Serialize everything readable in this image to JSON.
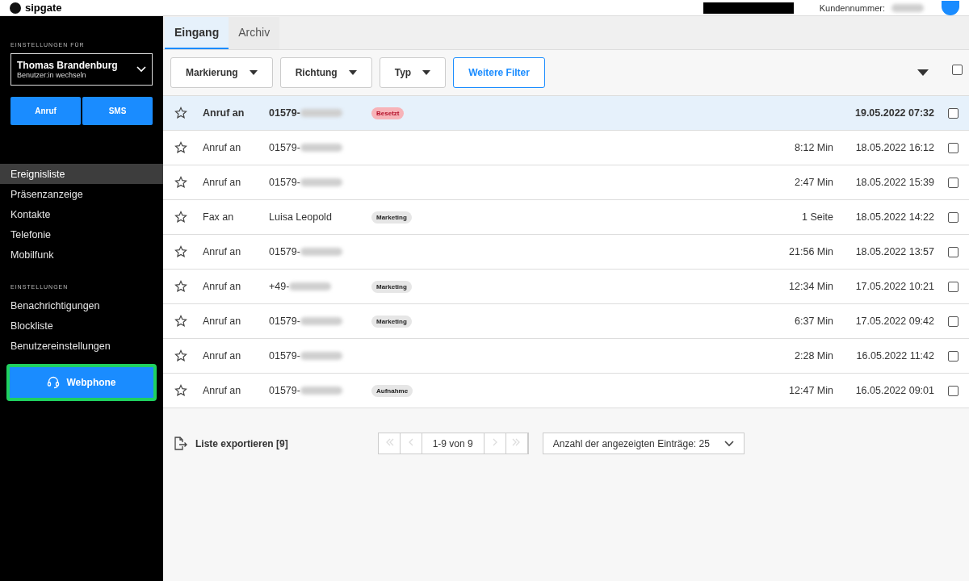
{
  "header": {
    "logo": "sipgate",
    "customer_label": "Kundennummer:"
  },
  "sidebar": {
    "section_label": "EINSTELLUNGEN FÜR",
    "user": {
      "name": "Thomas Brandenburg",
      "hint": "Benutzer:in wechseln"
    },
    "actions": [
      "Anruf",
      "SMS"
    ],
    "nav": [
      {
        "label": "Ereignisliste",
        "selected": true
      },
      {
        "label": "Präsenzanzeige",
        "selected": false
      },
      {
        "label": "Kontakte",
        "selected": false
      },
      {
        "label": "Telefonie",
        "selected": false
      },
      {
        "label": "Mobilfunk",
        "selected": false
      }
    ],
    "settings_label": "EINSTELLUNGEN",
    "settings": [
      {
        "label": "Benachrichtigungen",
        "selected": false
      },
      {
        "label": "Blockliste",
        "selected": false
      },
      {
        "label": "Benutzereinstellungen",
        "selected": false
      }
    ],
    "webphone": {
      "label": "Webphone",
      "highlighted": true
    }
  },
  "tabs": [
    {
      "label": "Eingang",
      "selected": true
    },
    {
      "label": "Archiv",
      "selected": false
    }
  ],
  "filters": [
    {
      "label": "Markierung",
      "kind": "dropdown"
    },
    {
      "label": "Richtung",
      "kind": "dropdown"
    },
    {
      "label": "Typ",
      "kind": "dropdown"
    },
    {
      "label": "Weitere Filter",
      "kind": "link"
    }
  ],
  "select_all": {
    "checked": false
  },
  "rows": [
    {
      "starred": false,
      "unread": true,
      "type": "Anruf an",
      "contact": "01579-",
      "redacted": true,
      "tag": {
        "label": "Besetzt",
        "color": "#f7b3b8"
      },
      "duration": "",
      "date": "19.05.2022 07:32",
      "checked": false
    },
    {
      "starred": false,
      "unread": false,
      "type": "Anruf an",
      "contact": "01579-",
      "redacted": true,
      "duration": "8:12 Min",
      "date": "18.05.2022 16:12",
      "checked": false
    },
    {
      "starred": false,
      "unread": false,
      "type": "Anruf an",
      "contact": "01579-",
      "redacted": true,
      "duration": "2:47 Min",
      "date": "18.05.2022 15:39",
      "checked": false
    },
    {
      "starred": false,
      "unread": false,
      "type": "Fax an",
      "contact": "Luisa Leopold",
      "redacted": false,
      "tag": {
        "label": "Marketing",
        "color": "#e6e6e6"
      },
      "duration": "1 Seite",
      "date": "18.05.2022 14:22",
      "checked": false
    },
    {
      "starred": false,
      "unread": false,
      "type": "Anruf an",
      "contact": "01579-",
      "redacted": true,
      "duration": "21:56 Min",
      "date": "18.05.2022 13:57",
      "checked": false
    },
    {
      "starred": false,
      "unread": false,
      "type": "Anruf an",
      "contact": "+49-",
      "redacted": true,
      "tag": {
        "label": "Marketing",
        "color": "#e6e6e6"
      },
      "duration": "12:34 Min",
      "date": "17.05.2022 10:21",
      "checked": false
    },
    {
      "starred": false,
      "unread": false,
      "type": "Anruf an",
      "contact": "01579-",
      "redacted": true,
      "tag": {
        "label": "Marketing",
        "color": "#e6e6e6"
      },
      "duration": "6:37 Min",
      "date": "17.05.2022 09:42",
      "checked": false
    },
    {
      "starred": false,
      "unread": false,
      "type": "Anruf an",
      "contact": "01579-",
      "redacted": true,
      "duration": "2:28 Min",
      "date": "16.05.2022 11:42",
      "checked": false
    },
    {
      "starred": false,
      "unread": false,
      "type": "Anruf an",
      "contact": "01579-",
      "redacted": true,
      "tag": {
        "label": "Aufnahme",
        "color": "#e6e6e6"
      },
      "duration": "12:47 Min",
      "date": "16.05.2022 09:01",
      "checked": false
    }
  ],
  "footer": {
    "export": "Liste exportieren [9]",
    "pagination": {
      "range": "1-9 von 9",
      "prev_disabled": true,
      "next_disabled": true
    },
    "page_size": "Anzahl der angezeigten Einträge: 25"
  }
}
